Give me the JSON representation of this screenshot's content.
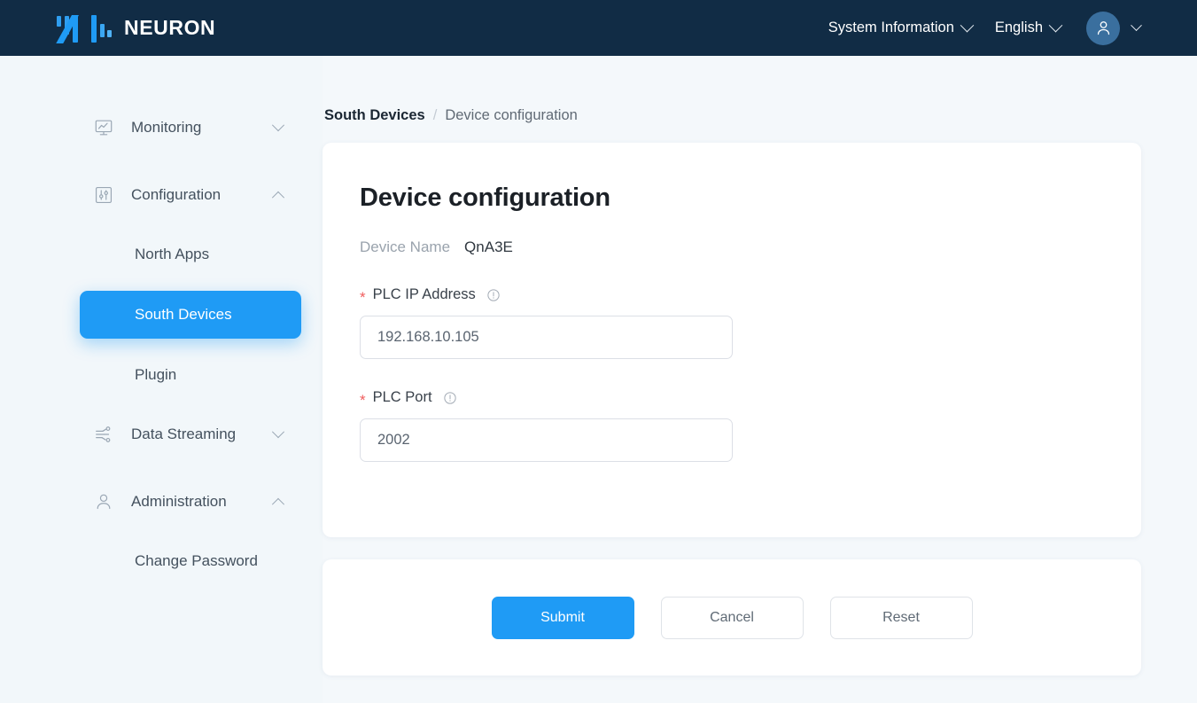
{
  "header": {
    "brand": "NEURON",
    "logo_icon": "neuron-logo-icon",
    "system_info_label": "System Information",
    "language_label": "English",
    "avatar_icon": "user-avatar-icon",
    "chevron_icon": "chevron-down-icon",
    "background_color": "#112c45",
    "accent_color": "#1f9bf5"
  },
  "sidebar": {
    "items": [
      {
        "label": "Monitoring",
        "icon": "monitor-chart-icon",
        "chevron": "down",
        "type": "group"
      },
      {
        "label": "Configuration",
        "icon": "sliders-box-icon",
        "chevron": "up",
        "type": "group"
      },
      {
        "label": "North Apps",
        "type": "sub",
        "active": false
      },
      {
        "label": "South Devices",
        "type": "sub",
        "active": true
      },
      {
        "label": "Plugin",
        "type": "sub",
        "active": false
      },
      {
        "label": "Data Streaming",
        "icon": "data-flow-icon",
        "chevron": "down",
        "type": "group"
      },
      {
        "label": "Administration",
        "icon": "person-icon",
        "chevron": "up",
        "type": "group"
      },
      {
        "label": "Change Password",
        "type": "sub",
        "active": false
      }
    ],
    "active_color": "#1f9bf5"
  },
  "breadcrumb": {
    "root": "South Devices",
    "separator": "/",
    "current": "Device configuration"
  },
  "form": {
    "title": "Device configuration",
    "device_name_label": "Device Name",
    "device_name_value": "QnA3E",
    "required_mark": "*",
    "info_icon": "info-circle-icon",
    "fields": [
      {
        "label": "PLC IP Address",
        "value": "192.168.10.105",
        "placeholder": "",
        "required": true
      },
      {
        "label": "PLC Port",
        "value": "2002",
        "placeholder": "",
        "required": true
      }
    ]
  },
  "actions": {
    "submit_label": "Submit",
    "cancel_label": "Cancel",
    "reset_label": "Reset"
  }
}
